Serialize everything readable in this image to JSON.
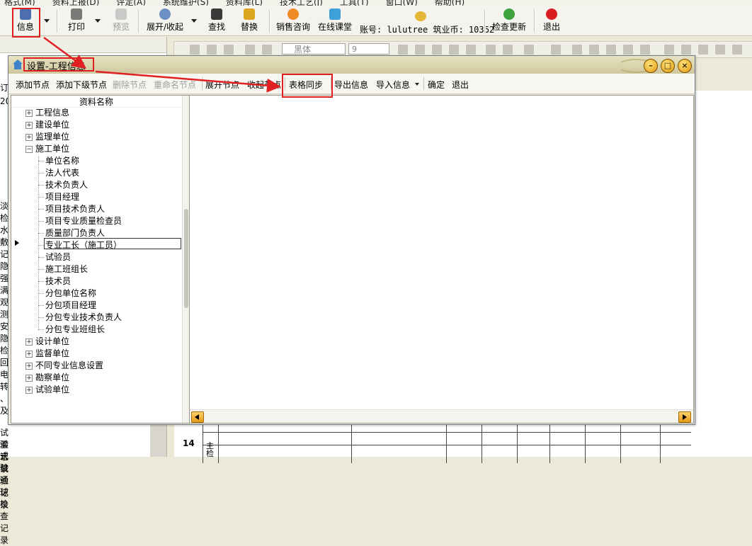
{
  "menubar": [
    "格式(M)",
    "资料上报(D)",
    "评定(A)",
    "系统维护(S)",
    "资料库(L)",
    "技术工艺(J)",
    "工具(T)",
    "窗口(W)",
    "帮助(H)"
  ],
  "toolbar": {
    "info": "信息",
    "print": "打印",
    "preview": "预览",
    "expand_collapse": "展开/收起",
    "find": "查找",
    "replace": "替换",
    "sales_consult": "销售咨询",
    "online_class": "在线课堂",
    "account": "账号: lulutree 筑业币: 10362",
    "check_update": "检查更新",
    "exit": "退出"
  },
  "format_toolbar": {
    "font": "黑体",
    "size": "9"
  },
  "background": {
    "left_truncated": [
      "订",
      "20",
      "淡",
      "检",
      "水",
      "敷",
      "记",
      "隐",
      "强",
      "满",
      "观",
      "测",
      "安",
      "隐",
      "检",
      "回",
      "电",
      "转",
      "、",
      "及"
    ],
    "left_bottom": [
      "试验记录",
      "灌水试验记录",
      "式验通球检查记录"
    ],
    "row_number": "14",
    "row_text": "主检"
  },
  "dialog": {
    "title": "设置-工程信息",
    "toolbar": {
      "add_node": "添加节点",
      "add_child_node": "添加下级节点",
      "delete_node": "删除节点",
      "rename_node": "重命名节点",
      "expand_node": "展开节点",
      "collapse_node": "收起节点",
      "table_sync": "表格同步",
      "export_info": "导出信息",
      "import_info": "导入信息",
      "confirm": "确定",
      "exit": "退出"
    },
    "tree": {
      "header": "资料名称",
      "roots": {
        "project_info": "工程信息",
        "construction_unit": "建设单位",
        "supervision_unit": "监理单位",
        "builder_unit": "施工单位",
        "design_unit": "设计单位",
        "oversight_unit": "监督单位",
        "discipline_settings": "不同专业信息设置",
        "survey_unit": "勘察单位",
        "test_unit": "试验单位"
      },
      "builder_children": [
        "单位名称",
        "法人代表",
        "技术负责人",
        "项目经理",
        "项目技术负责人",
        "项目专业质量检查员",
        "质量部门负责人",
        "专业工长（施工员）",
        "试验员",
        "施工班组长",
        "技术员",
        "分包单位名称",
        "分包项目经理",
        "分包专业技术负责人",
        "分包专业班组长"
      ],
      "selected": "专业工长（施工员）"
    }
  },
  "colors": {
    "annotation": "#e02020",
    "title_bar": "#d8d2a8"
  }
}
